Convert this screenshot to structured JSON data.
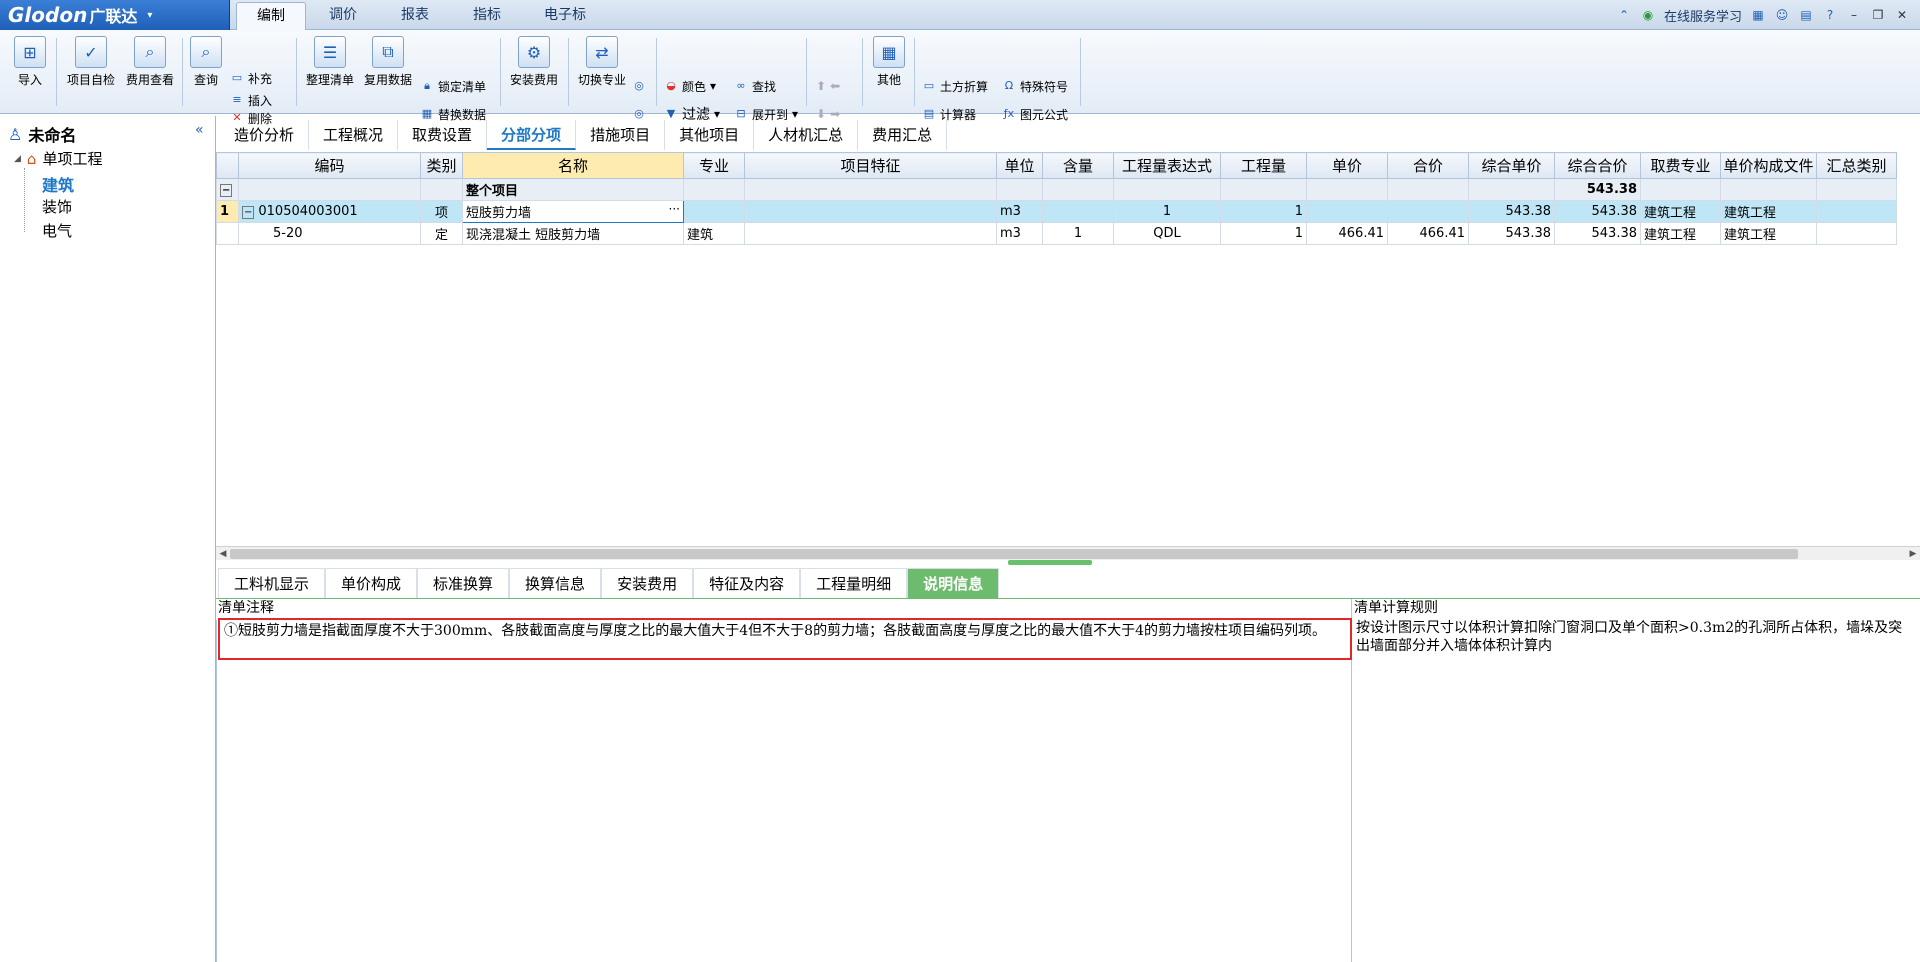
{
  "app": {
    "logo": "Glodon",
    "logo_cn": "广联达",
    "logo_arrow": "▾"
  },
  "menu": [
    "编制",
    "调价",
    "报表",
    "指标",
    "电子标"
  ],
  "topright": {
    "service": "在线服务学习"
  },
  "ribbon": {
    "import": "导入",
    "selfcheck": "项目自检",
    "feeview": "费用查看",
    "query": "查询",
    "supplement": "补充",
    "insert": "插入",
    "delete": "删除",
    "arrange": "整理清单",
    "reuse": "复用数据",
    "lock": "锁定清单",
    "replace": "替换数据",
    "install": "安装费用",
    "switch": "切换专业",
    "color": "颜色",
    "search": "查找",
    "filter": "过滤",
    "expand": "展开到",
    "other": "其他",
    "earthwork": "土方折算",
    "special": "特殊符号",
    "calc": "计算器",
    "formula": "图元公式"
  },
  "tree": {
    "root": "未命名",
    "project": "单项工程",
    "items": [
      "建筑",
      "装饰",
      "电气"
    ]
  },
  "tabs": [
    "造价分析",
    "工程概况",
    "取费设置",
    "分部分项",
    "措施项目",
    "其他项目",
    "人材机汇总",
    "费用汇总"
  ],
  "grid": {
    "headers": [
      "编码",
      "类别",
      "名称",
      "专业",
      "项目特征",
      "单位",
      "含量",
      "工程量表达式",
      "工程量",
      "单价",
      "合价",
      "综合单价",
      "综合合价",
      "取费专业",
      "单价构成文件",
      "汇总类别"
    ],
    "summary": {
      "name": "整个项目",
      "total": "543.38"
    },
    "rows": [
      {
        "idx": "1",
        "code": "010504003001",
        "type": "项",
        "name": "短肢剪力墙",
        "major": "",
        "feature": "",
        "unit": "m3",
        "qty": "",
        "expr": "1",
        "amount": "1",
        "price": "",
        "sum": "",
        "uprice": "543.38",
        "usum": "543.38",
        "feemajor": "建筑工程",
        "file": "建筑工程",
        "cat": ""
      },
      {
        "idx": "",
        "code": "5-20",
        "type": "定",
        "name": "现浇混凝土 短肢剪力墙",
        "major": "建筑",
        "feature": "",
        "unit": "m3",
        "qty": "1",
        "expr": "QDL",
        "amount": "1",
        "price": "466.41",
        "sum": "466.41",
        "uprice": "543.38",
        "usum": "543.38",
        "feemajor": "建筑工程",
        "file": "建筑工程",
        "cat": ""
      }
    ]
  },
  "bottabs": [
    "工料机显示",
    "单价构成",
    "标准换算",
    "换算信息",
    "安装费用",
    "特征及内容",
    "工程量明细",
    "说明信息"
  ],
  "notes": {
    "title": "清单注释",
    "text": "①短肢剪力墙是指截面厚度不大于300mm、各肢截面高度与厚度之比的最大值大于4但不大于8的剪力墙；各肢截面高度与厚度之比的最大值不大于4的剪力墙按柱项目编码列项。"
  },
  "rules": {
    "title": "清单计算规则",
    "text": "按设计图示尺寸以体积计算扣除门窗洞口及单个面积>0.3m2的孔洞所占体积，墙垛及突出墙面部分并入墙体体积计算内"
  }
}
